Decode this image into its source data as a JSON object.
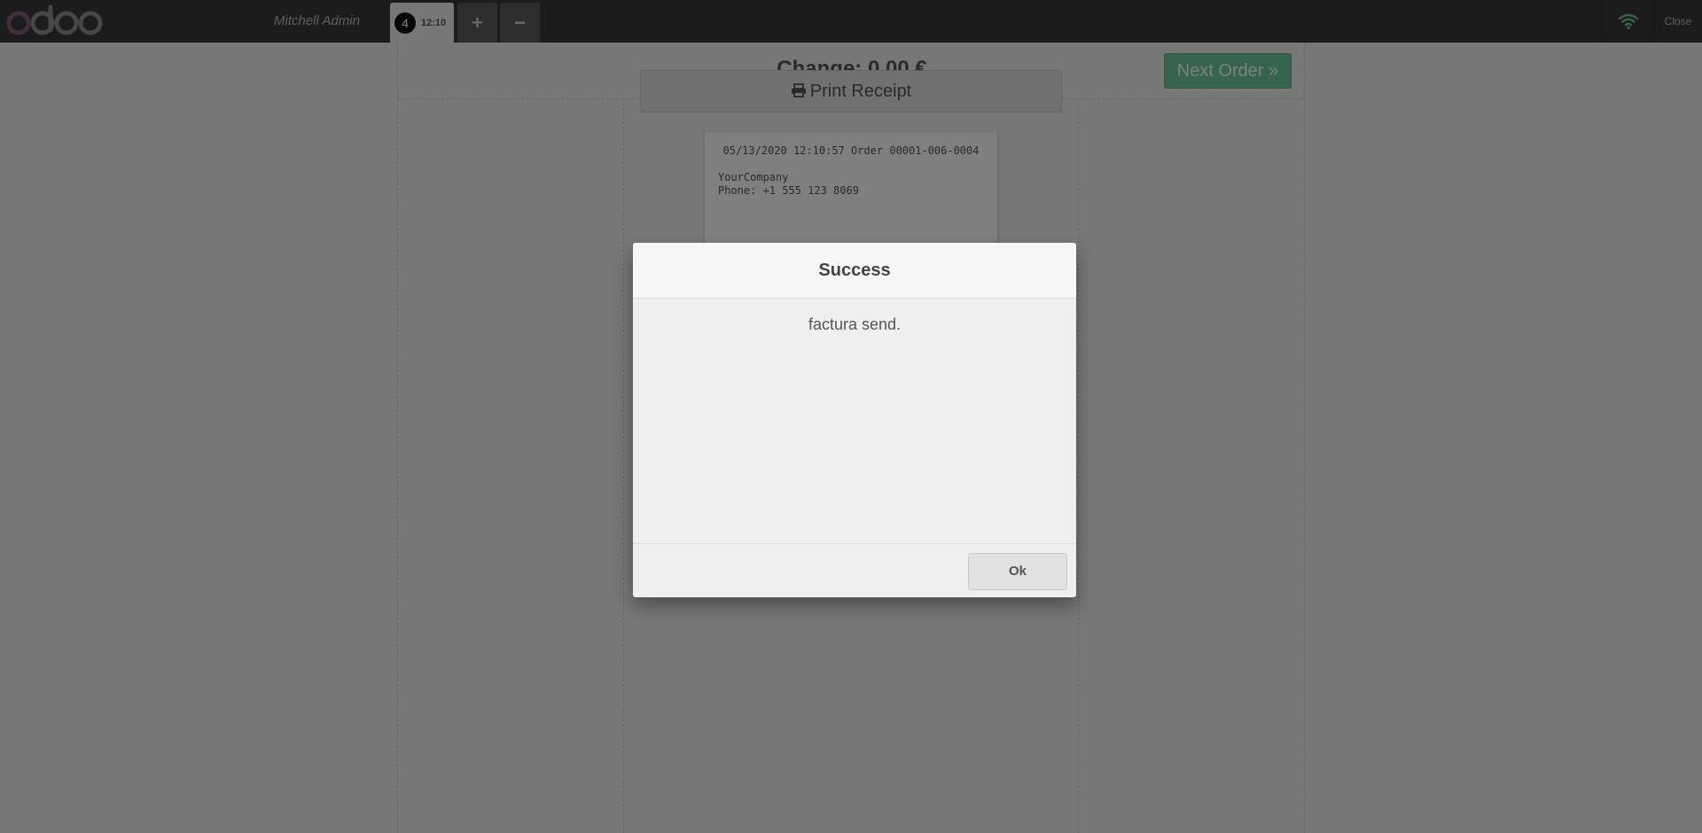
{
  "topbar": {
    "logo_text": "odoo",
    "cashier_name": "Mitchell Admin",
    "order": {
      "sequence": "4",
      "time": "12:10"
    },
    "add_order_label": "+",
    "remove_order_label": "−",
    "close_label": "Close",
    "connection_status_color": "#6ec89b"
  },
  "receipt_screen": {
    "change_text": "Change: 0.00 €",
    "next_order_label": "Next Order »",
    "print_receipt_label": "Print Receipt",
    "receipt": {
      "header": "05/13/2020 12:10:57 Order 00001-006-0004",
      "company": "YourCompany",
      "phone": "Phone: +1 555 123 8069"
    }
  },
  "dialog": {
    "title": "Success",
    "message": "factura send.",
    "ok_label": "Ok"
  },
  "colors": {
    "topbar_bg": "#393939",
    "accent_green": "#6ec89b",
    "logo_purple": "#875a7b",
    "background": "#f0eeee"
  }
}
